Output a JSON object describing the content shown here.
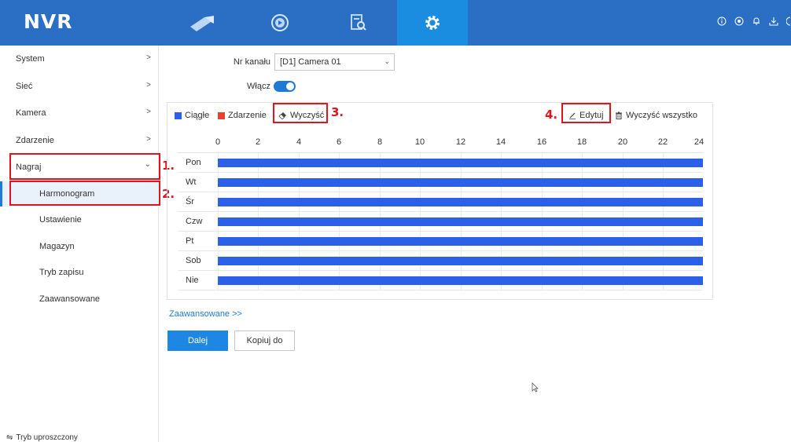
{
  "header": {
    "brand": "NVR",
    "tabs": [
      {
        "icon": "camera-icon",
        "active": false
      },
      {
        "icon": "playback-icon",
        "active": false
      },
      {
        "icon": "file-search-icon",
        "active": false
      },
      {
        "icon": "gear-icon",
        "active": true
      }
    ],
    "right_icons": [
      "info-icon",
      "circle-icon",
      "bell-icon",
      "download-icon"
    ]
  },
  "sidebar": {
    "items": [
      {
        "label": "System",
        "chevron": ">"
      },
      {
        "label": "Sieć",
        "chevron": ">"
      },
      {
        "label": "Kamera",
        "chevron": ">"
      },
      {
        "label": "Zdarzenie",
        "chevron": ">"
      },
      {
        "label": "Nagraj",
        "chevron": "⌄"
      }
    ],
    "sub_items": [
      {
        "label": "Harmonogram",
        "active": true
      },
      {
        "label": "Ustawienie",
        "active": false
      },
      {
        "label": "Magazyn",
        "active": false
      },
      {
        "label": "Tryb zapisu",
        "active": false
      },
      {
        "label": "Zaawansowane",
        "active": false
      }
    ],
    "simple_mode": {
      "icon_text": "⇋",
      "label": "Tryb uproszczony"
    }
  },
  "annotations": {
    "n1": "1.",
    "n2": "2.",
    "n3": "3.",
    "n4": "4."
  },
  "form": {
    "channel_label": "Nr kanału",
    "channel_value": "[D1] Camera 01",
    "enable_label": "Włącz",
    "enable_on": true
  },
  "schedule": {
    "legend": [
      {
        "label": "Ciągłe",
        "color": "#2c60e8"
      },
      {
        "label": "Zdarzenie",
        "color": "#e8402c"
      }
    ],
    "actions": {
      "clear_icon": "eraser-icon",
      "clear": "Wyczyść",
      "edit_icon": "pencil-icon",
      "edit": "Edytuj",
      "clear_all_icon": "trash-icon",
      "clear_all": "Wyczyść wszystko"
    },
    "hours": [
      "0",
      "2",
      "4",
      "6",
      "8",
      "10",
      "12",
      "14",
      "16",
      "18",
      "20",
      "22",
      "24"
    ],
    "days": [
      "Pon",
      "Wt",
      "Śr",
      "Czw",
      "Pt",
      "Sob",
      "Nie"
    ],
    "coverage": "continuous 0-24 all days"
  },
  "footer": {
    "advanced_link": "Zaawansowane >>",
    "next_button": "Dalej",
    "copy_button": "Kopiuj do"
  },
  "colors": {
    "header": "#2a6fc4",
    "active_tab": "#1a8de0",
    "accent": "#1e7ad6",
    "annotation": "#e0141e"
  }
}
